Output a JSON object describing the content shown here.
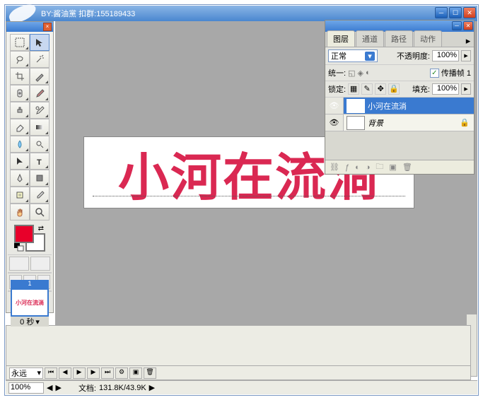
{
  "watermark": "BY:酱油黨 扣群:155189433",
  "canvas_text": "小河在流淌",
  "panel": {
    "tabs": [
      "图层",
      "通道",
      "路径",
      "动作"
    ],
    "blend_mode": "正常",
    "opacity_label": "不透明度:",
    "opacity_value": "100%",
    "unite_label": "统一:",
    "propagate_label": "传播帧 1",
    "lock_label": "锁定:",
    "fill_label": "填充:",
    "fill_value": "100%",
    "layers": [
      {
        "name": "小河在流淌",
        "type": "T",
        "selected": true
      },
      {
        "name": "背景",
        "type": "bg",
        "selected": false
      }
    ]
  },
  "animation": {
    "frame_num": "1",
    "frame_time": "0 秒",
    "loop": "永远"
  },
  "status": {
    "zoom": "100%",
    "doc_label": "文档:",
    "doc_info": "131.8K/43.9K"
  }
}
